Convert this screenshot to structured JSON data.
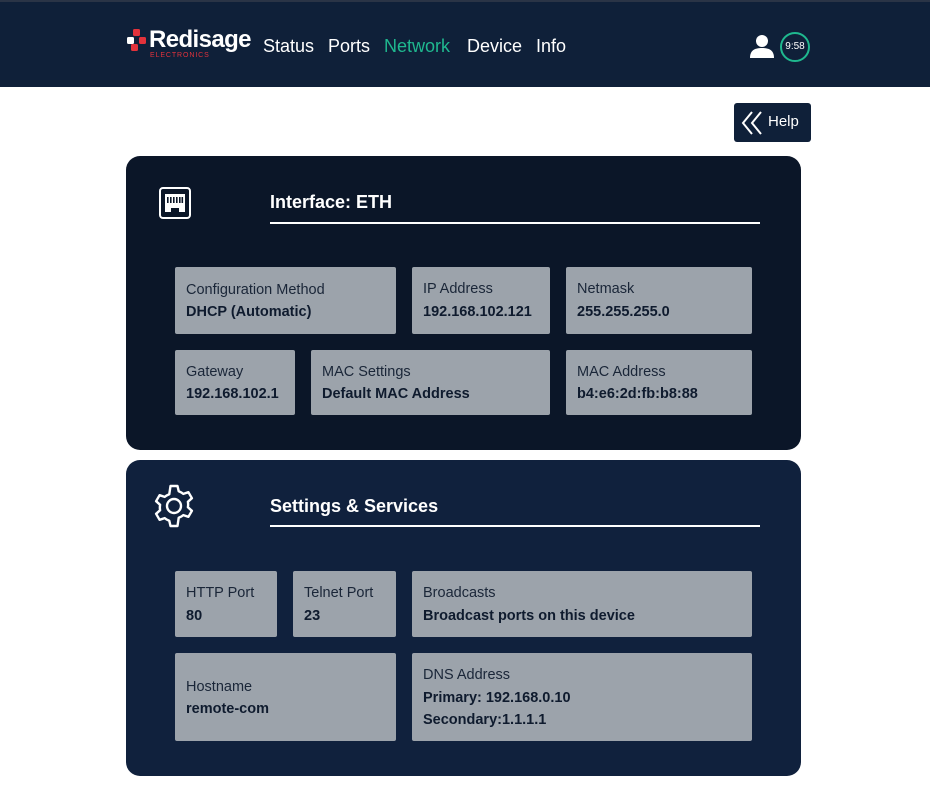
{
  "header": {
    "logo_text": "Redisage",
    "logo_sub": "ELECTRONICS",
    "nav": [
      "Status",
      "Ports",
      "Network",
      "Device",
      "Info"
    ],
    "active_nav": "Network",
    "clock": "9:58",
    "accent_color": "#1fb88f",
    "brand_color": "#e3323b"
  },
  "help": {
    "label": "Help"
  },
  "eth_card": {
    "icon": "ethernet-port-icon",
    "title": "Interface: ETH",
    "fields": [
      {
        "label": "Configuration Method",
        "value": "DHCP (Automatic)"
      },
      {
        "label": "IP Address",
        "value": "192.168.102.121"
      },
      {
        "label": "Netmask",
        "value": "255.255.255.0"
      },
      {
        "label": "Gateway",
        "value": "192.168.102.1"
      },
      {
        "label": "MAC Settings",
        "value": "Default MAC Address"
      },
      {
        "label": "MAC Address",
        "value": "b4:e6:2d:fb:b8:88"
      }
    ]
  },
  "settings_card": {
    "icon": "gear-icon",
    "title": "Settings & Services",
    "fields": [
      {
        "label": "HTTP Port",
        "value": "80"
      },
      {
        "label": "Telnet Port",
        "value": "23"
      },
      {
        "label": "Broadcasts",
        "value": "Broadcast ports on this device"
      },
      {
        "label": "Hostname",
        "value": "remote-com"
      },
      {
        "label": "DNS Address",
        "value": "Primary: 192.168.0.10",
        "value2": "Secondary:1.1.1.1"
      }
    ]
  }
}
